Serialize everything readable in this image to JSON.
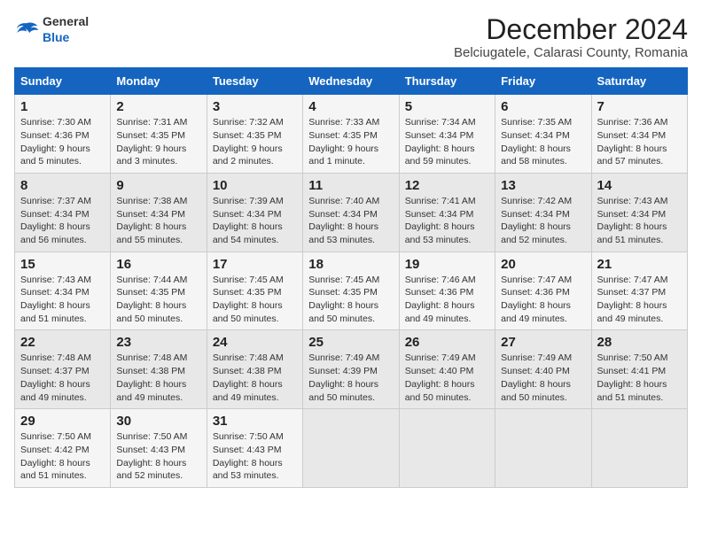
{
  "header": {
    "logo_general": "General",
    "logo_blue": "Blue",
    "title": "December 2024",
    "subtitle": "Belciugatele, Calarasi County, Romania"
  },
  "days_of_week": [
    "Sunday",
    "Monday",
    "Tuesday",
    "Wednesday",
    "Thursday",
    "Friday",
    "Saturday"
  ],
  "weeks": [
    [
      {
        "day": 1,
        "lines": [
          "Sunrise: 7:30 AM",
          "Sunset: 4:36 PM",
          "Daylight: 9 hours and 5 minutes."
        ]
      },
      {
        "day": 2,
        "lines": [
          "Sunrise: 7:31 AM",
          "Sunset: 4:35 PM",
          "Daylight: 9 hours and 3 minutes."
        ]
      },
      {
        "day": 3,
        "lines": [
          "Sunrise: 7:32 AM",
          "Sunset: 4:35 PM",
          "Daylight: 9 hours and 2 minutes."
        ]
      },
      {
        "day": 4,
        "lines": [
          "Sunrise: 7:33 AM",
          "Sunset: 4:35 PM",
          "Daylight: 9 hours and 1 minute."
        ]
      },
      {
        "day": 5,
        "lines": [
          "Sunrise: 7:34 AM",
          "Sunset: 4:34 PM",
          "Daylight: 8 hours and 59 minutes."
        ]
      },
      {
        "day": 6,
        "lines": [
          "Sunrise: 7:35 AM",
          "Sunset: 4:34 PM",
          "Daylight: 8 hours and 58 minutes."
        ]
      },
      {
        "day": 7,
        "lines": [
          "Sunrise: 7:36 AM",
          "Sunset: 4:34 PM",
          "Daylight: 8 hours and 57 minutes."
        ]
      }
    ],
    [
      {
        "day": 8,
        "lines": [
          "Sunrise: 7:37 AM",
          "Sunset: 4:34 PM",
          "Daylight: 8 hours and 56 minutes."
        ]
      },
      {
        "day": 9,
        "lines": [
          "Sunrise: 7:38 AM",
          "Sunset: 4:34 PM",
          "Daylight: 8 hours and 55 minutes."
        ]
      },
      {
        "day": 10,
        "lines": [
          "Sunrise: 7:39 AM",
          "Sunset: 4:34 PM",
          "Daylight: 8 hours and 54 minutes."
        ]
      },
      {
        "day": 11,
        "lines": [
          "Sunrise: 7:40 AM",
          "Sunset: 4:34 PM",
          "Daylight: 8 hours and 53 minutes."
        ]
      },
      {
        "day": 12,
        "lines": [
          "Sunrise: 7:41 AM",
          "Sunset: 4:34 PM",
          "Daylight: 8 hours and 53 minutes."
        ]
      },
      {
        "day": 13,
        "lines": [
          "Sunrise: 7:42 AM",
          "Sunset: 4:34 PM",
          "Daylight: 8 hours and 52 minutes."
        ]
      },
      {
        "day": 14,
        "lines": [
          "Sunrise: 7:43 AM",
          "Sunset: 4:34 PM",
          "Daylight: 8 hours and 51 minutes."
        ]
      }
    ],
    [
      {
        "day": 15,
        "lines": [
          "Sunrise: 7:43 AM",
          "Sunset: 4:34 PM",
          "Daylight: 8 hours and 51 minutes."
        ]
      },
      {
        "day": 16,
        "lines": [
          "Sunrise: 7:44 AM",
          "Sunset: 4:35 PM",
          "Daylight: 8 hours and 50 minutes."
        ]
      },
      {
        "day": 17,
        "lines": [
          "Sunrise: 7:45 AM",
          "Sunset: 4:35 PM",
          "Daylight: 8 hours and 50 minutes."
        ]
      },
      {
        "day": 18,
        "lines": [
          "Sunrise: 7:45 AM",
          "Sunset: 4:35 PM",
          "Daylight: 8 hours and 50 minutes."
        ]
      },
      {
        "day": 19,
        "lines": [
          "Sunrise: 7:46 AM",
          "Sunset: 4:36 PM",
          "Daylight: 8 hours and 49 minutes."
        ]
      },
      {
        "day": 20,
        "lines": [
          "Sunrise: 7:47 AM",
          "Sunset: 4:36 PM",
          "Daylight: 8 hours and 49 minutes."
        ]
      },
      {
        "day": 21,
        "lines": [
          "Sunrise: 7:47 AM",
          "Sunset: 4:37 PM",
          "Daylight: 8 hours and 49 minutes."
        ]
      }
    ],
    [
      {
        "day": 22,
        "lines": [
          "Sunrise: 7:48 AM",
          "Sunset: 4:37 PM",
          "Daylight: 8 hours and 49 minutes."
        ]
      },
      {
        "day": 23,
        "lines": [
          "Sunrise: 7:48 AM",
          "Sunset: 4:38 PM",
          "Daylight: 8 hours and 49 minutes."
        ]
      },
      {
        "day": 24,
        "lines": [
          "Sunrise: 7:48 AM",
          "Sunset: 4:38 PM",
          "Daylight: 8 hours and 49 minutes."
        ]
      },
      {
        "day": 25,
        "lines": [
          "Sunrise: 7:49 AM",
          "Sunset: 4:39 PM",
          "Daylight: 8 hours and 50 minutes."
        ]
      },
      {
        "day": 26,
        "lines": [
          "Sunrise: 7:49 AM",
          "Sunset: 4:40 PM",
          "Daylight: 8 hours and 50 minutes."
        ]
      },
      {
        "day": 27,
        "lines": [
          "Sunrise: 7:49 AM",
          "Sunset: 4:40 PM",
          "Daylight: 8 hours and 50 minutes."
        ]
      },
      {
        "day": 28,
        "lines": [
          "Sunrise: 7:50 AM",
          "Sunset: 4:41 PM",
          "Daylight: 8 hours and 51 minutes."
        ]
      }
    ],
    [
      {
        "day": 29,
        "lines": [
          "Sunrise: 7:50 AM",
          "Sunset: 4:42 PM",
          "Daylight: 8 hours and 51 minutes."
        ]
      },
      {
        "day": 30,
        "lines": [
          "Sunrise: 7:50 AM",
          "Sunset: 4:43 PM",
          "Daylight: 8 hours and 52 minutes."
        ]
      },
      {
        "day": 31,
        "lines": [
          "Sunrise: 7:50 AM",
          "Sunset: 4:43 PM",
          "Daylight: 8 hours and 53 minutes."
        ]
      },
      null,
      null,
      null,
      null
    ]
  ]
}
